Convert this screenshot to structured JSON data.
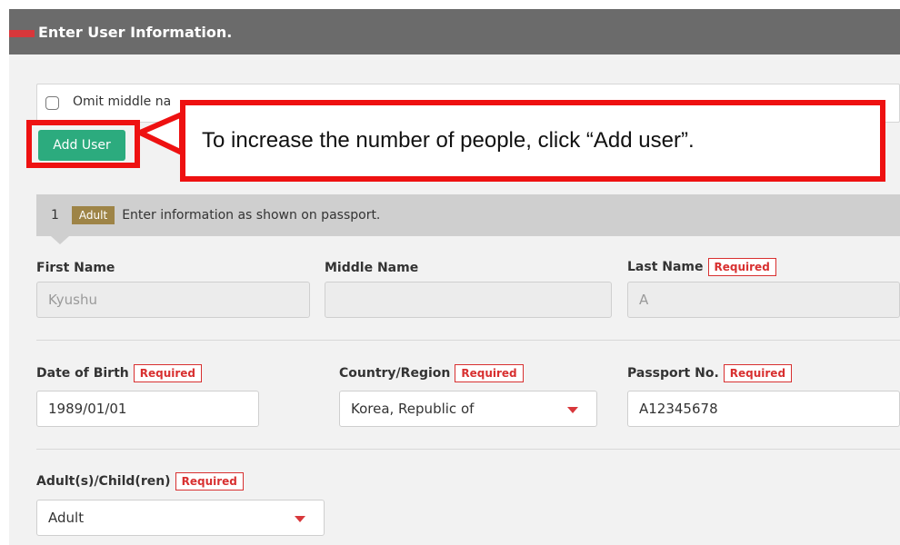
{
  "header": {
    "title": "Enter User Information."
  },
  "omit_middle_name": {
    "label": "Omit middle na",
    "checked": false
  },
  "add_user_button": {
    "label": "Add User"
  },
  "callout": {
    "text": "To increase the number of people, click “Add user”."
  },
  "person": {
    "number": "1",
    "badge": "Adult",
    "note": "Enter information as shown on passport."
  },
  "required_label": "Required",
  "fields": {
    "first_name": {
      "label": "First Name",
      "value": "Kyushu"
    },
    "middle_name": {
      "label": "Middle Name",
      "value": ""
    },
    "last_name": {
      "label": "Last Name",
      "value": "A"
    },
    "date_of_birth": {
      "label": "Date of Birth",
      "value": "1989/01/01"
    },
    "country_region": {
      "label": "Country/Region",
      "value": "Korea, Republic of"
    },
    "passport_no": {
      "label": "Passport No.",
      "value": "A12345678"
    },
    "adult_child": {
      "label": "Adult(s)/Child(ren)",
      "value": "Adult"
    }
  },
  "colors": {
    "header_bg": "#6b6b6b",
    "accent_red": "#d8373b",
    "add_button_green": "#2cab7e",
    "adult_badge": "#9e8447",
    "annotation_red": "#ee1111"
  }
}
